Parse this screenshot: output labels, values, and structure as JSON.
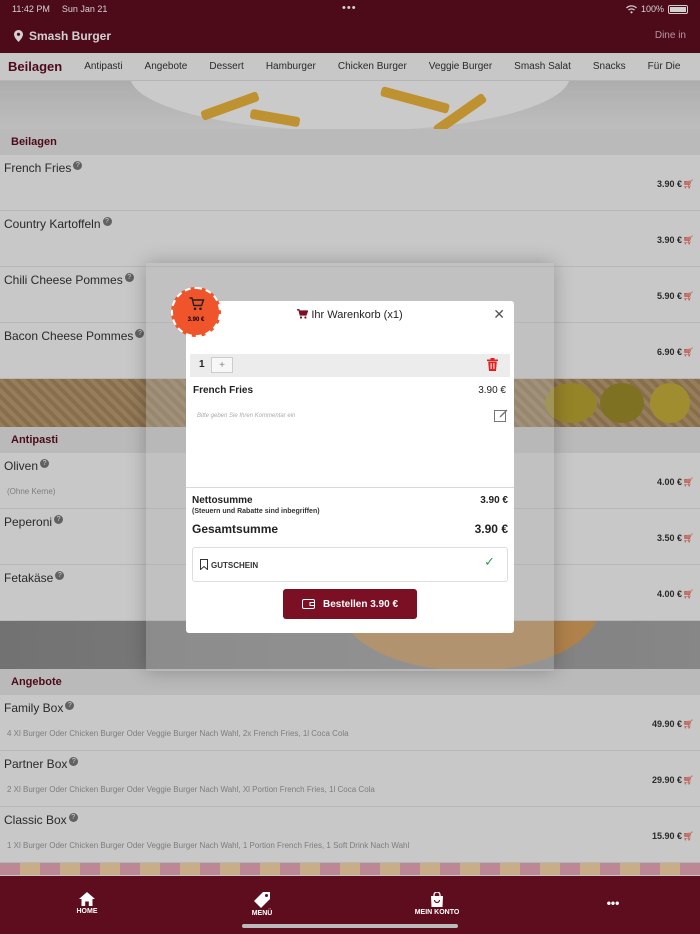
{
  "status": {
    "time": "11:42 PM",
    "date": "Sun Jan 21",
    "dots": "•••",
    "battery": "100%"
  },
  "header": {
    "brand": "Smash Burger",
    "mode": "Dine in"
  },
  "categories": [
    "Beilagen",
    "Antipasti",
    "Angebote",
    "Dessert",
    "Hamburger",
    "Chicken Burger",
    "Veggie Burger",
    "Smash Salat",
    "Snacks",
    "Für Die"
  ],
  "sections": {
    "beilagen": {
      "title": "Beilagen",
      "items": [
        {
          "name": "French Fries",
          "price": "3.90 €"
        },
        {
          "name": "Country Kartoffeln",
          "price": "3.90 €"
        },
        {
          "name": "Chili Cheese Pommes",
          "price": "5.90 €"
        },
        {
          "name": "Bacon Cheese Pommes",
          "price": "6.90 €"
        }
      ]
    },
    "antipasti": {
      "title": "Antipasti",
      "items": [
        {
          "name": "Oliven",
          "desc": "(Ohne Kerne)",
          "price": "4.00 €"
        },
        {
          "name": "Peperoni",
          "price": "3.50 €"
        },
        {
          "name": "Fetakäse",
          "price": "4.00 €"
        }
      ]
    },
    "angebote": {
      "title": "Angebote",
      "items": [
        {
          "name": "Family Box",
          "desc": "4 Xl Burger Oder Chicken Burger Oder Veggie Burger Nach Wahl, 2x French Fries, 1l Coca Cola",
          "price": "49.90 €"
        },
        {
          "name": "Partner Box",
          "desc": "2 Xl Burger Oder Chicken Burger Oder Veggie Burger Nach Wahl, Xl Portion French Fries, 1l Coca Cola",
          "price": "29.90 €"
        },
        {
          "name": "Classic Box",
          "desc": "1 Xl Burger Oder Chicken Burger Oder Veggie Burger Nach Wahl, 1 Portion French Fries, 1 Soft Drink Nach Wahl",
          "price": "15.90 €"
        }
      ]
    }
  },
  "cart": {
    "title": "Ihr Warenkorb (x1)",
    "badge_price": "3.90 €",
    "quantity": "1",
    "plus": "+",
    "item_name": "French Fries",
    "item_price": "3.90 €",
    "comment_placeholder": "Bitte geben Sie Ihren Kommentar ein",
    "net_label": "Nettosumme",
    "net_value": "3.90 €",
    "tax_note": "(Steuern und Rabatte sind inbegriffen)",
    "total_label": "Gesamtsumme",
    "total_value": "3.90 €",
    "coupon_label": "GUTSCHEIN",
    "order_button": "Bestellen 3.90 €"
  },
  "bottom_nav": {
    "home": "HOME",
    "menu": "MENÜ",
    "account": "MEIN KONTO",
    "more": "•••"
  },
  "colors": {
    "brand": "#5e0d1f",
    "button": "#7b1024",
    "accent": "#f0542a",
    "cart_icon": "#e84a3a",
    "check": "#2e9e4f"
  }
}
